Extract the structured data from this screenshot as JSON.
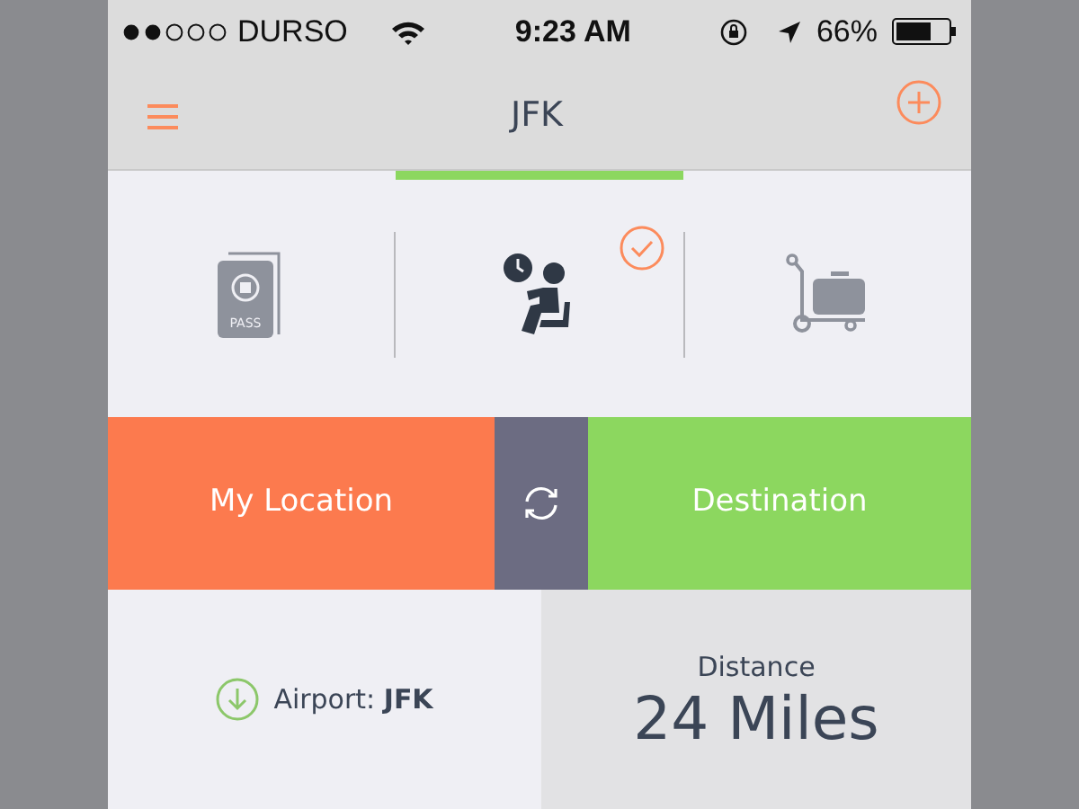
{
  "status_bar": {
    "carrier": "DURSO",
    "time": "9:23 AM",
    "battery": "66%"
  },
  "nav": {
    "title": "JFK"
  },
  "tabs": [
    {
      "kind": "passport",
      "label": "PASS",
      "selected": false
    },
    {
      "kind": "lounge",
      "selected": true
    },
    {
      "kind": "luggage",
      "selected": false
    }
  ],
  "route": {
    "origin": "My Location",
    "destination": "Destination"
  },
  "airport": {
    "label": "Airport: **JFK**"
  },
  "distance": {
    "label": "Distance",
    "value": "24 Miles"
  }
}
